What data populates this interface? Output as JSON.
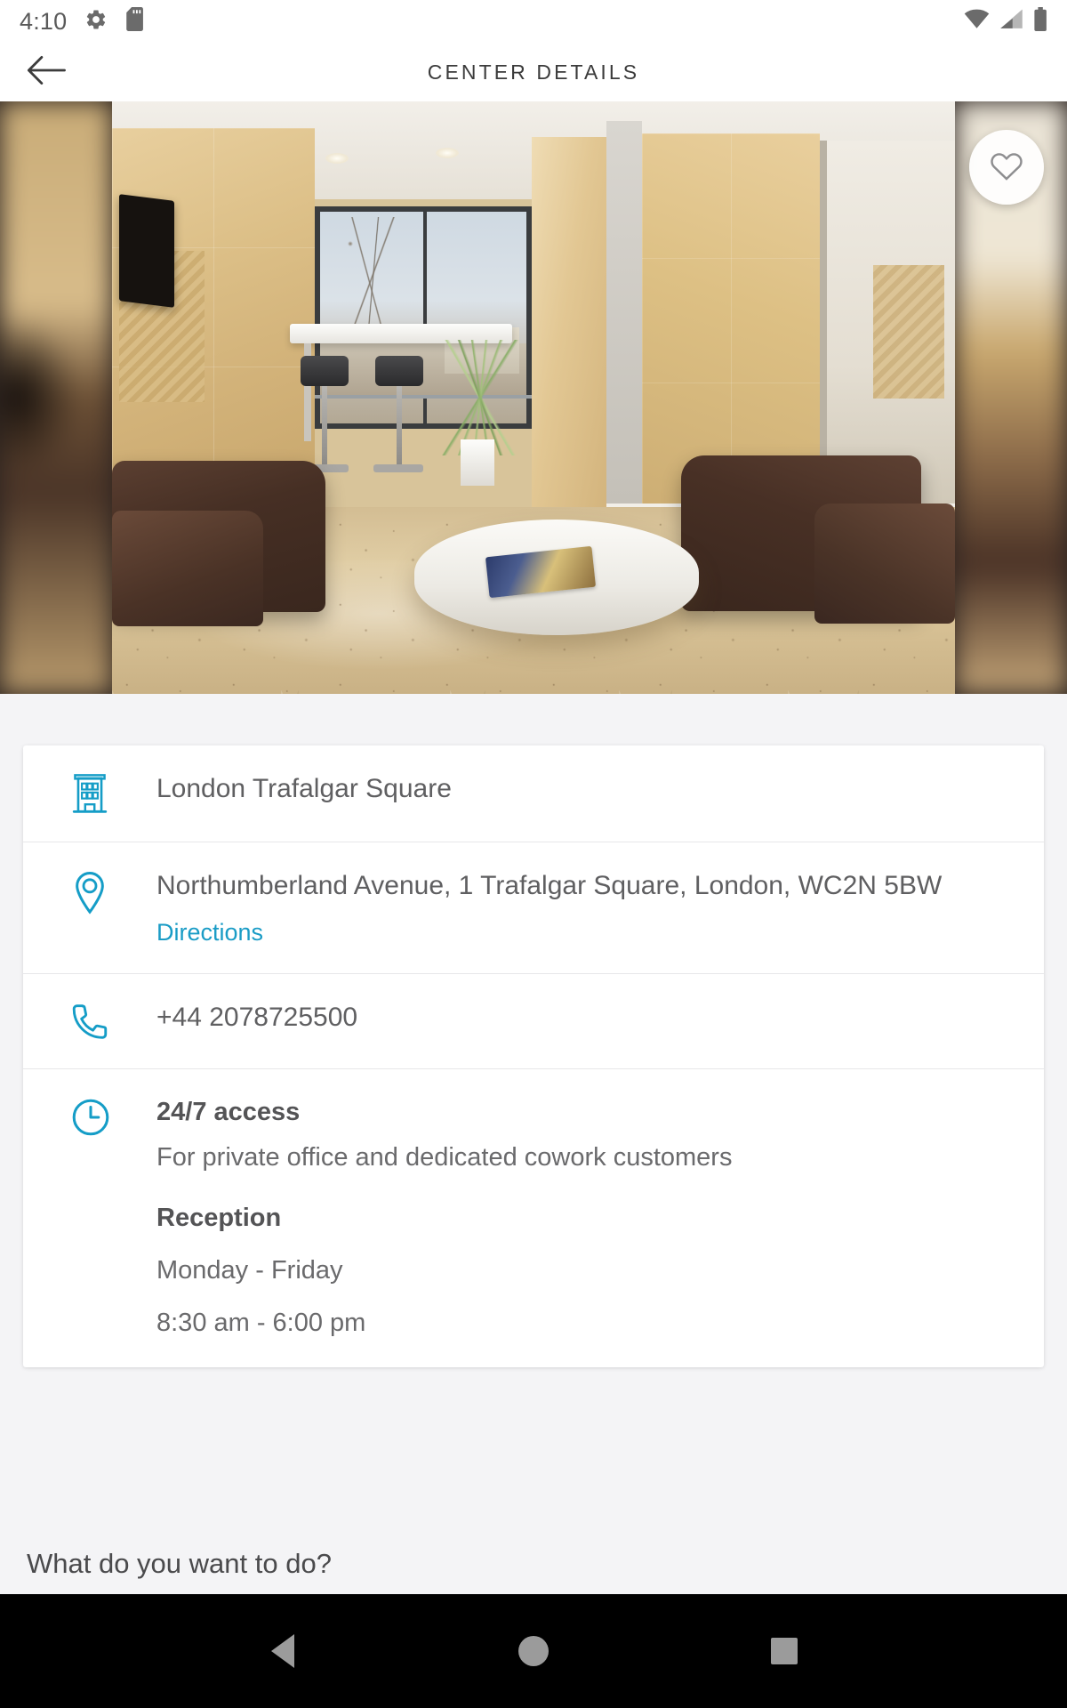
{
  "status_bar": {
    "time": "4:10",
    "icons_left": [
      "settings-gear-icon",
      "sd-card-icon"
    ],
    "icons_right": [
      "wifi-icon",
      "cellular-signal-icon",
      "battery-icon"
    ]
  },
  "app_bar": {
    "back_icon": "back-arrow-icon",
    "title": "CENTER DETAILS"
  },
  "hero": {
    "favorite_icon": "heart-outline-icon",
    "alt": "Center lobby interior photo"
  },
  "card": {
    "center_name": {
      "icon": "building-icon",
      "value": "London Trafalgar Square"
    },
    "address": {
      "icon": "map-pin-icon",
      "value": "Northumberland Avenue, 1 Trafalgar Square, London, WC2N 5BW",
      "link_label": "Directions"
    },
    "phone": {
      "icon": "phone-icon",
      "value": "+44 2078725500"
    },
    "hours": {
      "icon": "clock-icon",
      "access_title": "24/7 access",
      "access_note": "For private office and dedicated cowork customers",
      "reception_title": "Reception",
      "reception_days": "Monday - Friday",
      "reception_time": "8:30 am - 6:00 pm"
    }
  },
  "section": {
    "question": "What do you want to do?"
  },
  "nav_bar": {
    "back_icon": "nav-back-triangle-icon",
    "home_icon": "nav-home-circle-icon",
    "recents_icon": "nav-recents-square-icon"
  },
  "colors": {
    "accent": "#1a9cc6",
    "page_bg": "#f4f4f6",
    "card_bg": "#ffffff",
    "text": "#5f5f61",
    "nav_bg": "#000000"
  }
}
